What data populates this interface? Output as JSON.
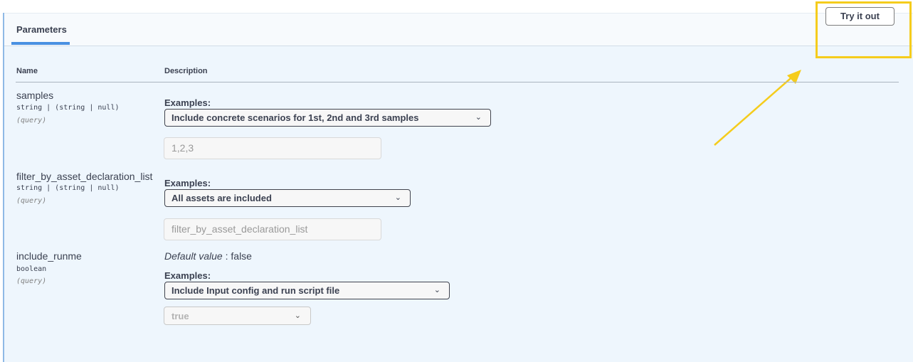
{
  "tabs": {
    "parameters": "Parameters"
  },
  "try_it_out_label": "Try it out",
  "columns": {
    "name": "Name",
    "description": "Description"
  },
  "params": [
    {
      "name": "samples",
      "type": "string | (string | null)",
      "in": "(query)",
      "examples_label": "Examples:",
      "selected_example": "Include concrete scenarios for 1st, 2nd and 3rd samples",
      "input_value": "1,2,3"
    },
    {
      "name": "filter_by_asset_declaration_list",
      "type": "string | (string | null)",
      "in": "(query)",
      "examples_label": "Examples:",
      "selected_example": "All assets are included",
      "input_placeholder": "filter_by_asset_declaration_list"
    },
    {
      "name": "include_runme",
      "type": "boolean",
      "in": "(query)",
      "default_label": "Default value",
      "default_sep": " : ",
      "default_value": "false",
      "examples_label": "Examples:",
      "selected_example": "Include Input config and run script file",
      "bool_value": "true"
    }
  ],
  "icons": {
    "dropdown": "chevron-down-icon",
    "annotation": "arrow-icon"
  },
  "colors": {
    "highlight": "#f5cc1c",
    "tab_underline": "#4990e2",
    "panel_bg": "#eef6fd"
  }
}
